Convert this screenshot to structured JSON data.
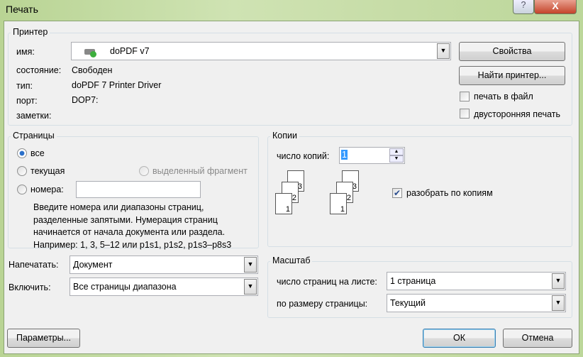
{
  "window": {
    "title": "Печать",
    "help": "?",
    "close": "X"
  },
  "printer": {
    "group": "Принтер",
    "name_label": "имя:",
    "name_value": "doPDF v7",
    "status_label": "состояние:",
    "status_value": "Свободен",
    "type_label": "тип:",
    "type_value": "doPDF 7 Printer Driver",
    "port_label": "порт:",
    "port_value": "DOP7:",
    "notes_label": "заметки:",
    "properties": "Свойства",
    "find": "Найти принтер...",
    "print_to_file": "печать в файл",
    "duplex": "двусторонняя печать"
  },
  "pages": {
    "group": "Страницы",
    "all": "все",
    "current": "текущая",
    "selection": "выделенный фрагмент",
    "numbers": "номера:",
    "numbers_value": "",
    "hint": "Введите номера или диапазоны страниц, разделенные запятыми. Нумерация страниц начинается от начала документа или раздела. Например: 1, 3, 5–12 или p1s1, p1s2, p1s3–p8s3"
  },
  "copies": {
    "group": "Копии",
    "count_label": "число копий:",
    "count_value": "1",
    "collate": "разобрать по копиям",
    "collate_checked": true,
    "page_numbers": [
      "3",
      "2",
      "1"
    ]
  },
  "print_what": {
    "label": "Напечатать:",
    "value": "Документ"
  },
  "include": {
    "label": "Включить:",
    "value": "Все страницы диапазона"
  },
  "scale": {
    "group": "Масштаб",
    "per_sheet_label": "число страниц на листе:",
    "per_sheet_value": "1 страница",
    "fit_label": "по размеру страницы:",
    "fit_value": "Текущий"
  },
  "buttons": {
    "options": "Параметры...",
    "ok": "ОК",
    "cancel": "Отмена"
  }
}
